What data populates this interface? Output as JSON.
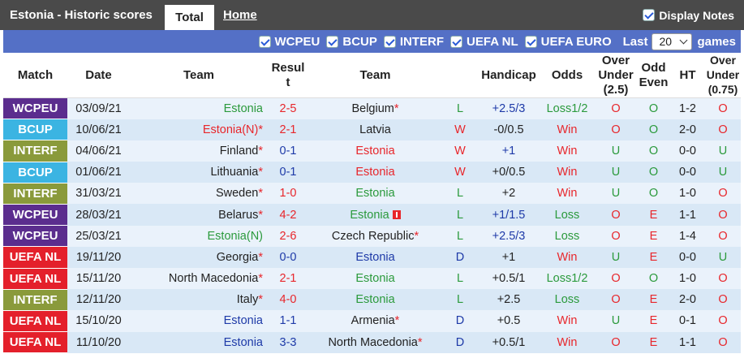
{
  "header": {
    "title": "Estonia - Historic scores",
    "tab_total": "Total",
    "tab_home": "Home",
    "display_notes": "Display Notes"
  },
  "filters": {
    "items": [
      "WCPEU",
      "BCUP",
      "INTERF",
      "UEFA NL",
      "UEFA EURO"
    ],
    "last_label": "Last",
    "last_value": "20",
    "games_label": "games"
  },
  "columns": {
    "match": "Match",
    "date": "Date",
    "team1": "Team",
    "result": "Result",
    "team2": "Team",
    "handicap": "Handicap",
    "odds": "Odds",
    "over_under": "Over Under (2.5)",
    "odd_even": "Odd Even",
    "ht": "HT",
    "over_under2": "Over Under (0.75)"
  },
  "colors": {
    "WCPEU": "#5b2d8e",
    "BCUP": "#3bb4e2",
    "INTERF": "#8a9a3b",
    "UEFA NL": "#e4202b"
  },
  "rows": [
    {
      "comp": "WCPEU",
      "date": "03/09/21",
      "home": "Estonia",
      "home_star": "",
      "home_cls": "c-eston",
      "score": "2-5",
      "score_cls": "c-red",
      "away": "Belgium",
      "away_star": "*",
      "away_cls": "",
      "flag": false,
      "wl": "L",
      "wl_cls": "c-loss",
      "hcap": "+2.5/3",
      "hcap_cls": "c-blue",
      "odds": "Loss1/2",
      "odds_cls": "c-loss",
      "ou": "O",
      "ou_cls": "c-red",
      "oe": "O",
      "oe_cls": "c-loss",
      "ht": "1-2",
      "ou2": "O",
      "ou2_cls": "c-red"
    },
    {
      "comp": "BCUP",
      "date": "10/06/21",
      "home": "Estonia(N)",
      "home_star": "*",
      "home_cls": "c-red",
      "score": "2-1",
      "score_cls": "c-red",
      "away": "Latvia",
      "away_star": "",
      "away_cls": "",
      "flag": false,
      "wl": "W",
      "wl_cls": "c-red",
      "hcap": "-0/0.5",
      "hcap_cls": "",
      "odds": "Win",
      "odds_cls": "c-red",
      "ou": "O",
      "ou_cls": "c-red",
      "oe": "O",
      "oe_cls": "c-loss",
      "ht": "2-0",
      "ou2": "O",
      "ou2_cls": "c-red"
    },
    {
      "comp": "INTERF",
      "date": "04/06/21",
      "home": "Finland",
      "home_star": "*",
      "home_cls": "",
      "score": "0-1",
      "score_cls": "c-blue",
      "away": "Estonia",
      "away_star": "",
      "away_cls": "c-red",
      "flag": false,
      "wl": "W",
      "wl_cls": "c-red",
      "hcap": "+1",
      "hcap_cls": "c-blue",
      "odds": "Win",
      "odds_cls": "c-red",
      "ou": "U",
      "ou_cls": "c-loss",
      "oe": "O",
      "oe_cls": "c-loss",
      "ht": "0-0",
      "ou2": "U",
      "ou2_cls": "c-loss"
    },
    {
      "comp": "BCUP",
      "date": "01/06/21",
      "home": "Lithuania",
      "home_star": "*",
      "home_cls": "",
      "score": "0-1",
      "score_cls": "c-blue",
      "away": "Estonia",
      "away_star": "",
      "away_cls": "c-red",
      "flag": false,
      "wl": "W",
      "wl_cls": "c-red",
      "hcap": "+0/0.5",
      "hcap_cls": "",
      "odds": "Win",
      "odds_cls": "c-red",
      "ou": "U",
      "ou_cls": "c-loss",
      "oe": "O",
      "oe_cls": "c-loss",
      "ht": "0-0",
      "ou2": "U",
      "ou2_cls": "c-loss"
    },
    {
      "comp": "INTERF",
      "date": "31/03/21",
      "home": "Sweden",
      "home_star": "*",
      "home_cls": "",
      "score": "1-0",
      "score_cls": "c-red",
      "away": "Estonia",
      "away_star": "",
      "away_cls": "c-eston",
      "flag": false,
      "wl": "L",
      "wl_cls": "c-loss",
      "hcap": "+2",
      "hcap_cls": "",
      "odds": "Win",
      "odds_cls": "c-red",
      "ou": "U",
      "ou_cls": "c-loss",
      "oe": "O",
      "oe_cls": "c-loss",
      "ht": "1-0",
      "ou2": "O",
      "ou2_cls": "c-red"
    },
    {
      "comp": "WCPEU",
      "date": "28/03/21",
      "home": "Belarus",
      "home_star": "*",
      "home_cls": "",
      "score": "4-2",
      "score_cls": "c-red",
      "away": "Estonia",
      "away_star": "",
      "away_cls": "c-eston",
      "flag": true,
      "wl": "L",
      "wl_cls": "c-loss",
      "hcap": "+1/1.5",
      "hcap_cls": "c-blue",
      "odds": "Loss",
      "odds_cls": "c-loss",
      "ou": "O",
      "ou_cls": "c-red",
      "oe": "E",
      "oe_cls": "c-red",
      "ht": "1-1",
      "ou2": "O",
      "ou2_cls": "c-red"
    },
    {
      "comp": "WCPEU",
      "date": "25/03/21",
      "home": "Estonia(N)",
      "home_star": "",
      "home_cls": "c-eston",
      "score": "2-6",
      "score_cls": "c-red",
      "away": "Czech Republic",
      "away_star": "*",
      "away_cls": "",
      "flag": false,
      "wl": "L",
      "wl_cls": "c-loss",
      "hcap": "+2.5/3",
      "hcap_cls": "c-blue",
      "odds": "Loss",
      "odds_cls": "c-loss",
      "ou": "O",
      "ou_cls": "c-red",
      "oe": "E",
      "oe_cls": "c-red",
      "ht": "1-4",
      "ou2": "O",
      "ou2_cls": "c-red"
    },
    {
      "comp": "UEFA NL",
      "date": "19/11/20",
      "home": "Georgia",
      "home_star": "*",
      "home_cls": "",
      "score": "0-0",
      "score_cls": "c-blue",
      "away": "Estonia",
      "away_star": "",
      "away_cls": "c-blue",
      "flag": false,
      "wl": "D",
      "wl_cls": "c-draw",
      "hcap": "+1",
      "hcap_cls": "",
      "odds": "Win",
      "odds_cls": "c-red",
      "ou": "U",
      "ou_cls": "c-loss",
      "oe": "E",
      "oe_cls": "c-red",
      "ht": "0-0",
      "ou2": "U",
      "ou2_cls": "c-loss"
    },
    {
      "comp": "UEFA NL",
      "date": "15/11/20",
      "home": "North Macedonia",
      "home_star": "*",
      "home_cls": "",
      "score": "2-1",
      "score_cls": "c-red",
      "away": "Estonia",
      "away_star": "",
      "away_cls": "c-eston",
      "flag": false,
      "wl": "L",
      "wl_cls": "c-loss",
      "hcap": "+0.5/1",
      "hcap_cls": "",
      "odds": "Loss1/2",
      "odds_cls": "c-loss",
      "ou": "O",
      "ou_cls": "c-red",
      "oe": "O",
      "oe_cls": "c-loss",
      "ht": "1-0",
      "ou2": "O",
      "ou2_cls": "c-red"
    },
    {
      "comp": "INTERF",
      "date": "12/11/20",
      "home": "Italy",
      "home_star": "*",
      "home_cls": "",
      "score": "4-0",
      "score_cls": "c-red",
      "away": "Estonia",
      "away_star": "",
      "away_cls": "c-eston",
      "flag": false,
      "wl": "L",
      "wl_cls": "c-loss",
      "hcap": "+2.5",
      "hcap_cls": "",
      "odds": "Loss",
      "odds_cls": "c-loss",
      "ou": "O",
      "ou_cls": "c-red",
      "oe": "E",
      "oe_cls": "c-red",
      "ht": "2-0",
      "ou2": "O",
      "ou2_cls": "c-red"
    },
    {
      "comp": "UEFA NL",
      "date": "15/10/20",
      "home": "Estonia",
      "home_star": "",
      "home_cls": "c-blue",
      "score": "1-1",
      "score_cls": "c-blue",
      "away": "Armenia",
      "away_star": "*",
      "away_cls": "",
      "flag": false,
      "wl": "D",
      "wl_cls": "c-draw",
      "hcap": "+0.5",
      "hcap_cls": "",
      "odds": "Win",
      "odds_cls": "c-red",
      "ou": "U",
      "ou_cls": "c-loss",
      "oe": "E",
      "oe_cls": "c-red",
      "ht": "0-1",
      "ou2": "O",
      "ou2_cls": "c-red"
    },
    {
      "comp": "UEFA NL",
      "date": "11/10/20",
      "home": "Estonia",
      "home_star": "",
      "home_cls": "c-blue",
      "score": "3-3",
      "score_cls": "c-blue",
      "away": "North Macedonia",
      "away_star": "*",
      "away_cls": "",
      "flag": false,
      "wl": "D",
      "wl_cls": "c-draw",
      "hcap": "+0.5/1",
      "hcap_cls": "",
      "odds": "Win",
      "odds_cls": "c-red",
      "ou": "O",
      "ou_cls": "c-red",
      "oe": "E",
      "oe_cls": "c-red",
      "ht": "1-1",
      "ou2": "O",
      "ou2_cls": "c-red"
    }
  ]
}
